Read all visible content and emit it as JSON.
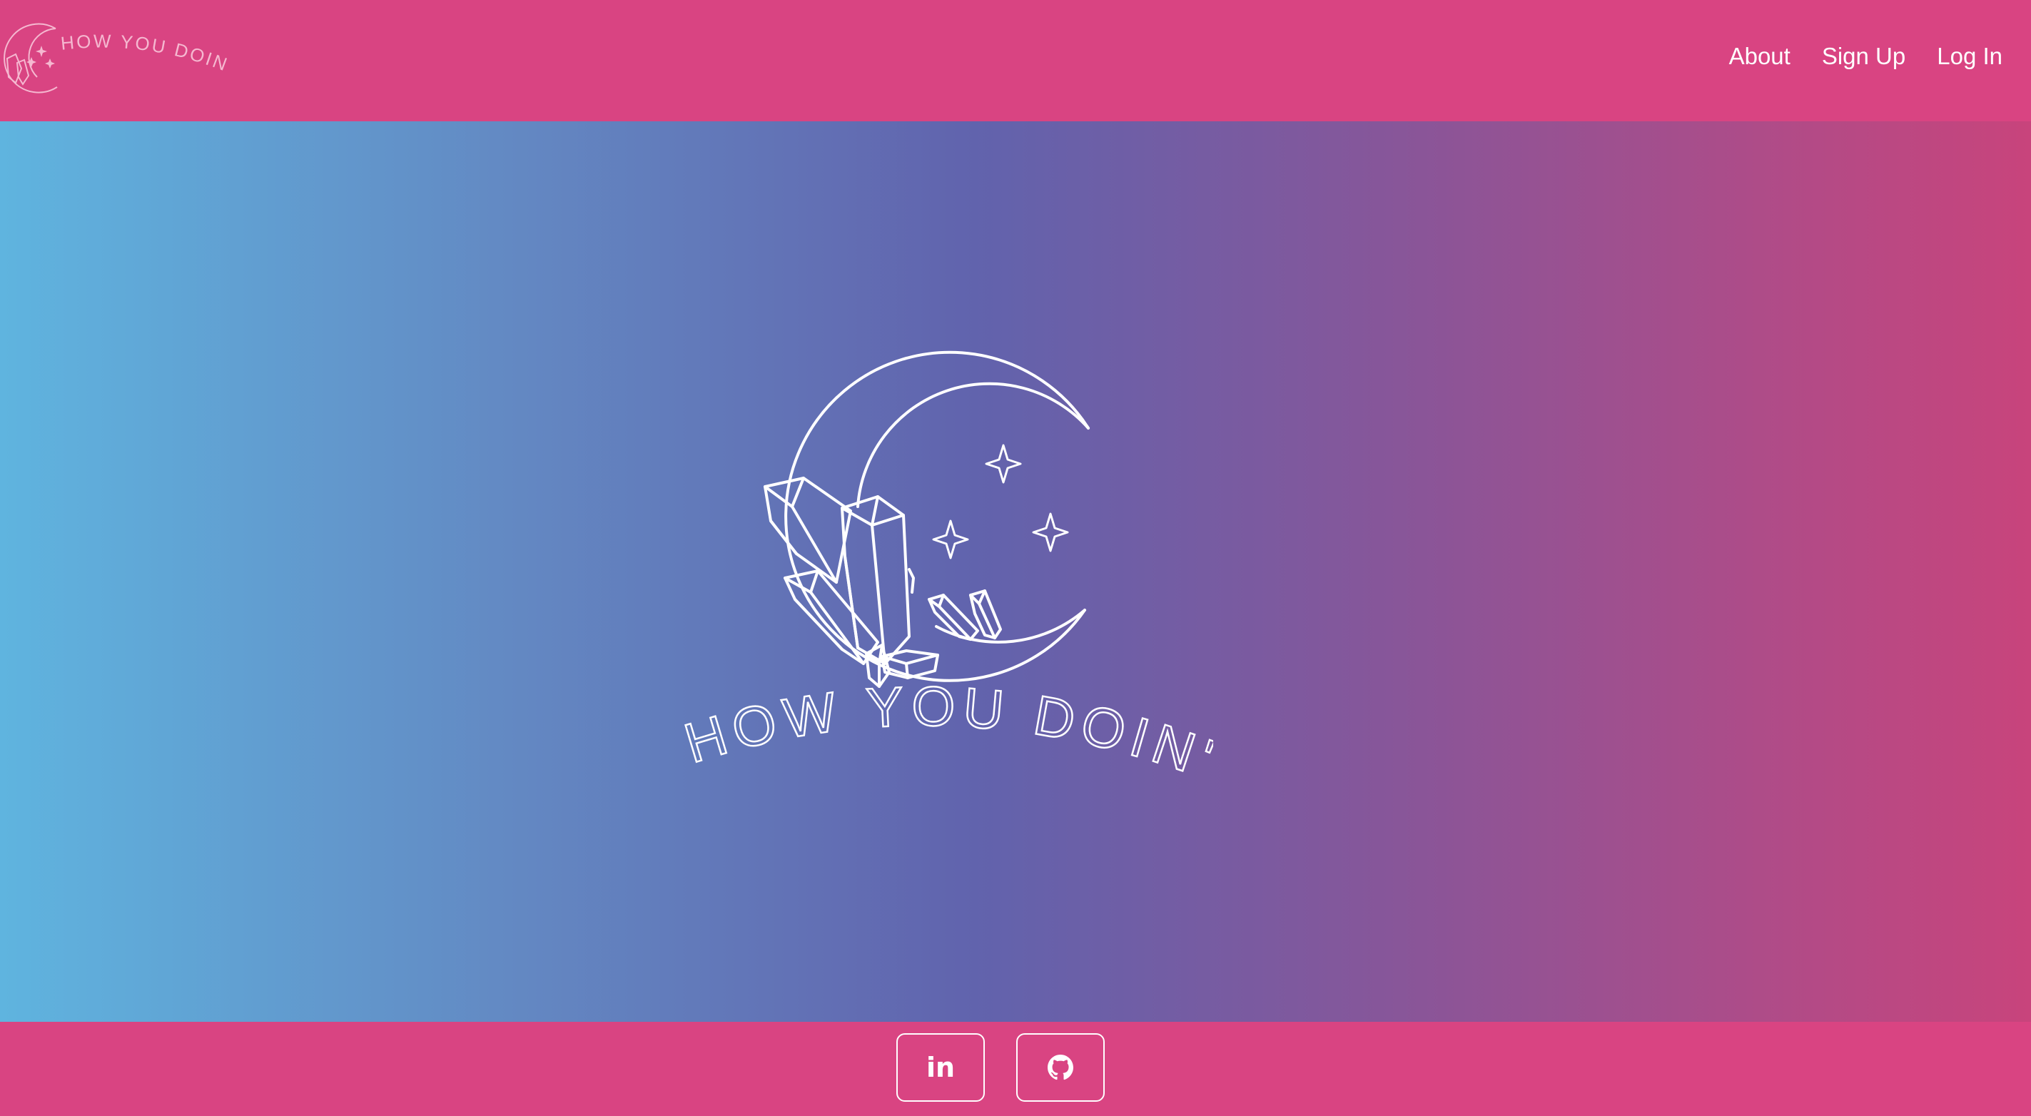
{
  "brand": {
    "name": "HOW YOU DOIN'?",
    "logo_icon": "moon-crystals-logo"
  },
  "nav": {
    "links": [
      {
        "label": "About"
      },
      {
        "label": "Sign Up"
      },
      {
        "label": "Log In"
      }
    ]
  },
  "hero": {
    "logo_text": "HOW YOU DOIN'?",
    "logo_icon": "moon-crystals-logo"
  },
  "footer": {
    "linkedin": {
      "icon": "linkedin-icon",
      "label": "in"
    },
    "github": {
      "icon": "github-icon"
    }
  },
  "colors": {
    "primary_pink": "#d94482",
    "gradient_start": "#5fb4df",
    "gradient_mid": "#6163ad",
    "gradient_end": "#c8447c",
    "text": "#ffffff"
  }
}
